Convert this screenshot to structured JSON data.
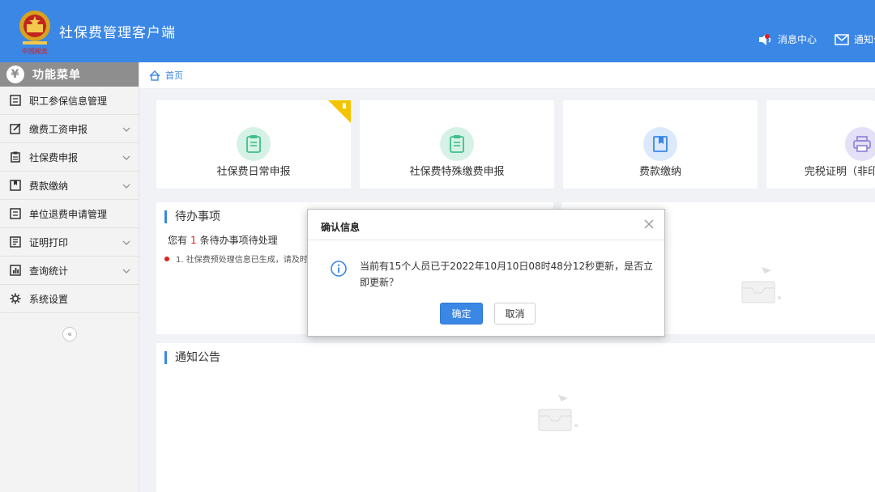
{
  "header": {
    "title": "社保费管理客户端",
    "msg_center": "消息中心",
    "notice": "通知公"
  },
  "sidebar": {
    "title": "功能菜单",
    "items": [
      {
        "label": "职工参保信息管理",
        "icon": "list-icon",
        "has_sub": false
      },
      {
        "label": "缴费工资申报",
        "icon": "edit-icon",
        "has_sub": true
      },
      {
        "label": "社保费申报",
        "icon": "clipboard-icon",
        "has_sub": true
      },
      {
        "label": "费款缴纳",
        "icon": "book-icon",
        "has_sub": true
      },
      {
        "label": "单位退费申请管理",
        "icon": "list-icon",
        "has_sub": false
      },
      {
        "label": "证明打印",
        "icon": "print-icon",
        "has_sub": true
      },
      {
        "label": "查询统计",
        "icon": "chart-icon",
        "has_sub": true
      },
      {
        "label": "系统设置",
        "icon": "gear-icon",
        "has_sub": false
      }
    ],
    "collapse": "«"
  },
  "breadcrumb": {
    "home": "首页"
  },
  "cards": [
    {
      "label": "社保费日常申报",
      "icon": "clipboard-icon",
      "color": "#3fbf8a"
    },
    {
      "label": "社保费特殊缴费申报",
      "icon": "clipboard-icon",
      "color": "#3fbf8a"
    },
    {
      "label": "费款缴纳",
      "icon": "book-icon",
      "color": "#3b87e6"
    },
    {
      "label": "完税证明（非印",
      "icon": "printer-icon",
      "color": "#8a7fd6"
    }
  ],
  "todo": {
    "title": "待办事项",
    "prefix": "您有",
    "count": "1",
    "suffix": "条待办事项待处理",
    "item": "1. 社保费预处理信息已生成，请及时"
  },
  "notice_panel": {
    "title": "通知公告"
  },
  "dialog": {
    "title": "确认信息",
    "message": "当前有15个人员已于2022年10月10日08时48分12秒更新，是否立即更新？",
    "ok": "确定",
    "cancel": "取消"
  },
  "colors": {
    "primary": "#3b87e6",
    "badge": "#f5c400",
    "alert": "#e02020"
  }
}
